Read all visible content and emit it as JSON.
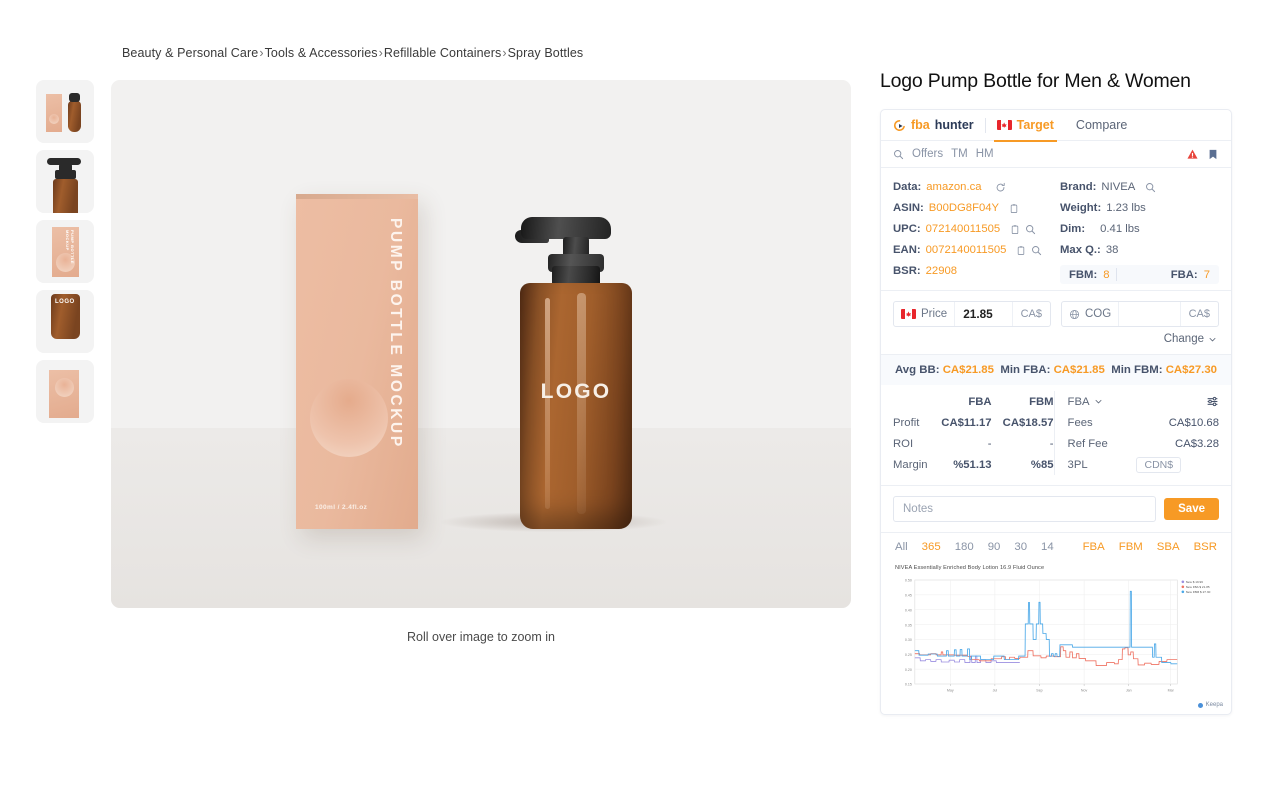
{
  "breadcrumb": {
    "items": [
      "Beauty & Personal Care",
      "Tools & Accessories",
      "Refillable Containers",
      "Spray Bottles"
    ],
    "separator": "›"
  },
  "gallery": {
    "zoom_caption": "Roll over image to zoom in",
    "thumbnails": [
      {
        "name": "thumbnail-box-and-bottle"
      },
      {
        "name": "thumbnail-pump-closeup"
      },
      {
        "name": "thumbnail-box-front"
      },
      {
        "name": "thumbnail-bottle-logo"
      },
      {
        "name": "thumbnail-box-angled"
      }
    ]
  },
  "product_image": {
    "box_text": "PUMP BOTTLE MOCKUP",
    "box_size": "100ml / 2.4fl.oz",
    "bottle_logo": "LOGO"
  },
  "panel": {
    "product_title": "Logo Pump Bottle for Men & Women",
    "brand_fba": "fba",
    "brand_hunter": "hunter",
    "tabs": [
      {
        "label": "Target",
        "active": true
      },
      {
        "label": "Compare",
        "active": false
      }
    ],
    "offers": {
      "offers_label": "Offers",
      "tm_label": "TM",
      "hm_label": "HM"
    },
    "data_left": [
      {
        "label": "Data:",
        "value": "amazon.ca"
      },
      {
        "label": "ASIN:",
        "value": "B00DG8F04Y"
      },
      {
        "label": "UPC:",
        "value": "072140011505"
      },
      {
        "label": "EAN:",
        "value": "0072140011505"
      },
      {
        "label": "BSR:",
        "value": "22908"
      }
    ],
    "data_right": [
      {
        "label": "Brand:",
        "value": "NIVEA"
      },
      {
        "label": "Weight:",
        "value": "1.23 lbs"
      },
      {
        "label": "Dim:",
        "value": "0.41 lbs"
      },
      {
        "label": "Max Q.:",
        "value": "38"
      }
    ],
    "fbm_label": "FBM:",
    "fbm_value": "8",
    "fba_label": "FBA:",
    "fba_value": "7",
    "price": {
      "label": "Price",
      "value": "21.85",
      "currency": "CA$"
    },
    "cog": {
      "label": "COG",
      "value": "",
      "currency": "CA$"
    },
    "change_label": "Change",
    "buybox": [
      {
        "label": "Avg BB:",
        "value": "CA$21.85"
      },
      {
        "label": "Min FBA:",
        "value": "CA$21.85"
      },
      {
        "label": "Min FBM:",
        "value": "CA$27.30"
      }
    ],
    "profit_table": {
      "col_fba": "FBA",
      "col_fbm": "FBM",
      "rows": [
        {
          "key": "Profit",
          "fba": "CA$11.17",
          "fbm": "CA$18.57",
          "green": true
        },
        {
          "key": "ROI",
          "fba": "-",
          "fbm": "-",
          "green": false
        },
        {
          "key": "Margin",
          "fba": "%51.13",
          "fbm": "%85",
          "green": true
        }
      ]
    },
    "fees_table": {
      "selector": "FBA",
      "rows": [
        {
          "key": "Fees",
          "value": "CA$10.68"
        },
        {
          "key": "Ref Fee",
          "value": "CA$3.28"
        }
      ],
      "threepl_key": "3PL",
      "threepl_chip": "CDN$"
    },
    "notes": {
      "placeholder": "Notes",
      "value": "",
      "save_label": "Save"
    },
    "filters": {
      "ranges": [
        {
          "label": "All",
          "active": false
        },
        {
          "label": "365",
          "active": true
        },
        {
          "label": "180",
          "active": false
        },
        {
          "label": "90",
          "active": false
        },
        {
          "label": "30",
          "active": false
        },
        {
          "label": "14",
          "active": false
        }
      ],
      "series_toggles": [
        {
          "label": "FBA",
          "active": true
        },
        {
          "label": "FBM",
          "active": true
        },
        {
          "label": "SBA",
          "active": true
        },
        {
          "label": "BSR",
          "active": true
        }
      ]
    },
    "keepa_label": "Keepa"
  },
  "chart_data": {
    "type": "line",
    "title": "NIVEA Essentially Enriched Body Lotion 16.9 Fluid Ounce",
    "xlabel": "",
    "ylabel": "",
    "ylim": [
      0.15,
      0.5
    ],
    "yticks": [
      0.15,
      0.2,
      0.25,
      0.3,
      0.35,
      0.4,
      0.45,
      0.5
    ],
    "ytick_labels": [
      "0.15",
      "0.20",
      "0.25",
      "0.30",
      "0.35",
      "0.40",
      "0.45",
      "0.50"
    ],
    "xticks": [
      0.135,
      0.305,
      0.475,
      0.645,
      0.815,
      0.975
    ],
    "xtick_labels": [
      "May",
      "Jul",
      "Sep",
      "Nov",
      "Jan",
      "Mar"
    ],
    "grid": true,
    "legend_position": "top-right",
    "legend": [
      {
        "label": "New $ 19.96",
        "color": "#9b8fe0"
      },
      {
        "label": "New FBA $ 21.85",
        "color": "#ef7363"
      },
      {
        "label": "New FBM $ 27.30",
        "color": "#4aa8e8"
      }
    ],
    "series": [
      {
        "name": "New FBM $ 27.30",
        "color": "#4aa8e8",
        "points": [
          [
            0.0,
            0.262
          ],
          [
            0.015,
            0.262
          ],
          [
            0.016,
            0.247
          ],
          [
            0.05,
            0.247
          ],
          [
            0.051,
            0.251
          ],
          [
            0.085,
            0.251
          ],
          [
            0.086,
            0.244
          ],
          [
            0.12,
            0.244
          ],
          [
            0.121,
            0.262
          ],
          [
            0.127,
            0.262
          ],
          [
            0.128,
            0.244
          ],
          [
            0.15,
            0.244
          ],
          [
            0.151,
            0.265
          ],
          [
            0.157,
            0.265
          ],
          [
            0.158,
            0.244
          ],
          [
            0.172,
            0.244
          ],
          [
            0.173,
            0.266
          ],
          [
            0.179,
            0.266
          ],
          [
            0.18,
            0.244
          ],
          [
            0.2,
            0.244
          ],
          [
            0.201,
            0.268
          ],
          [
            0.208,
            0.268
          ],
          [
            0.209,
            0.232
          ],
          [
            0.215,
            0.232
          ],
          [
            0.216,
            0.244
          ],
          [
            0.25,
            0.244
          ],
          [
            0.251,
            0.232
          ],
          [
            0.3,
            0.232
          ],
          [
            0.301,
            0.244
          ],
          [
            0.34,
            0.244
          ],
          [
            0.341,
            0.232
          ],
          [
            0.395,
            0.232
          ],
          [
            0.396,
            0.244
          ],
          [
            0.42,
            0.244
          ],
          [
            0.421,
            0.352
          ],
          [
            0.432,
            0.352
          ],
          [
            0.433,
            0.424
          ],
          [
            0.437,
            0.424
          ],
          [
            0.438,
            0.352
          ],
          [
            0.45,
            0.352
          ],
          [
            0.451,
            0.3
          ],
          [
            0.462,
            0.3
          ],
          [
            0.463,
            0.352
          ],
          [
            0.472,
            0.352
          ],
          [
            0.473,
            0.425
          ],
          [
            0.477,
            0.425
          ],
          [
            0.478,
            0.352
          ],
          [
            0.487,
            0.352
          ],
          [
            0.488,
            0.32
          ],
          [
            0.5,
            0.32
          ],
          [
            0.501,
            0.3
          ],
          [
            0.512,
            0.3
          ],
          [
            0.513,
            0.243
          ],
          [
            0.52,
            0.243
          ],
          [
            0.521,
            0.252
          ],
          [
            0.527,
            0.252
          ],
          [
            0.528,
            0.243
          ],
          [
            0.534,
            0.243
          ],
          [
            0.535,
            0.252
          ],
          [
            0.541,
            0.252
          ],
          [
            0.542,
            0.243
          ],
          [
            0.552,
            0.243
          ],
          [
            0.553,
            0.282
          ],
          [
            0.6,
            0.282
          ],
          [
            0.601,
            0.274
          ],
          [
            0.82,
            0.274
          ],
          [
            0.821,
            0.462
          ],
          [
            0.825,
            0.462
          ],
          [
            0.826,
            0.274
          ],
          [
            0.905,
            0.274
          ],
          [
            0.906,
            0.24
          ],
          [
            0.912,
            0.24
          ],
          [
            0.913,
            0.285
          ],
          [
            0.918,
            0.285
          ],
          [
            0.919,
            0.24
          ],
          [
            0.94,
            0.24
          ],
          [
            0.941,
            0.222
          ],
          [
            0.975,
            0.222
          ],
          [
            0.976,
            0.218
          ],
          [
            1.0,
            0.218
          ]
        ]
      },
      {
        "name": "New FBA $ 21.85",
        "color": "#ef7363",
        "points": [
          [
            0.0,
            0.252
          ],
          [
            0.018,
            0.252
          ],
          [
            0.019,
            0.248
          ],
          [
            0.06,
            0.248
          ],
          [
            0.061,
            0.252
          ],
          [
            0.08,
            0.252
          ],
          [
            0.081,
            0.248
          ],
          [
            0.1,
            0.248
          ],
          [
            0.101,
            0.258
          ],
          [
            0.106,
            0.258
          ],
          [
            0.107,
            0.248
          ],
          [
            0.15,
            0.248
          ],
          [
            0.151,
            0.247
          ],
          [
            0.2,
            0.247
          ],
          [
            0.201,
            0.243
          ],
          [
            0.215,
            0.243
          ],
          [
            0.216,
            0.232
          ],
          [
            0.245,
            0.232
          ],
          [
            0.246,
            0.228
          ],
          [
            0.29,
            0.228
          ],
          [
            0.291,
            0.235
          ],
          [
            0.33,
            0.235
          ],
          [
            0.331,
            0.242
          ],
          [
            0.345,
            0.242
          ],
          [
            0.346,
            0.232
          ],
          [
            0.36,
            0.232
          ],
          [
            0.361,
            0.24
          ],
          [
            0.38,
            0.24
          ],
          [
            0.381,
            0.236
          ],
          [
            0.4,
            0.236
          ],
          [
            0.401,
            0.24
          ],
          [
            0.43,
            0.24
          ],
          [
            0.431,
            0.262
          ],
          [
            0.45,
            0.262
          ],
          [
            0.451,
            0.245
          ],
          [
            0.48,
            0.245
          ],
          [
            0.481,
            0.238
          ],
          [
            0.5,
            0.238
          ],
          [
            0.501,
            0.244
          ],
          [
            0.53,
            0.244
          ],
          [
            0.531,
            0.242
          ],
          [
            0.555,
            0.242
          ],
          [
            0.556,
            0.275
          ],
          [
            0.565,
            0.275
          ],
          [
            0.566,
            0.262
          ],
          [
            0.575,
            0.262
          ],
          [
            0.576,
            0.24
          ],
          [
            0.59,
            0.24
          ],
          [
            0.591,
            0.258
          ],
          [
            0.6,
            0.258
          ],
          [
            0.601,
            0.238
          ],
          [
            0.615,
            0.238
          ],
          [
            0.616,
            0.252
          ],
          [
            0.625,
            0.252
          ],
          [
            0.626,
            0.236
          ],
          [
            0.65,
            0.236
          ],
          [
            0.651,
            0.228
          ],
          [
            0.69,
            0.228
          ],
          [
            0.691,
            0.212
          ],
          [
            0.73,
            0.212
          ],
          [
            0.731,
            0.222
          ],
          [
            0.76,
            0.222
          ],
          [
            0.761,
            0.218
          ],
          [
            0.775,
            0.218
          ],
          [
            0.776,
            0.232
          ],
          [
            0.79,
            0.232
          ],
          [
            0.791,
            0.268
          ],
          [
            0.8,
            0.268
          ],
          [
            0.801,
            0.272
          ],
          [
            0.812,
            0.272
          ],
          [
            0.813,
            0.248
          ],
          [
            0.822,
            0.248
          ],
          [
            0.823,
            0.258
          ],
          [
            0.832,
            0.258
          ],
          [
            0.833,
            0.235
          ],
          [
            0.85,
            0.235
          ],
          [
            0.851,
            0.214
          ],
          [
            0.875,
            0.214
          ],
          [
            0.876,
            0.22
          ],
          [
            0.9,
            0.22
          ],
          [
            0.901,
            0.216
          ],
          [
            0.93,
            0.216
          ],
          [
            0.931,
            0.226
          ],
          [
            0.96,
            0.226
          ],
          [
            0.961,
            0.232
          ],
          [
            1.0,
            0.232
          ]
        ]
      },
      {
        "name": "New $ 19.96",
        "color": "#9b8fe0",
        "points": [
          [
            0.0,
            0.238
          ],
          [
            0.02,
            0.238
          ],
          [
            0.021,
            0.228
          ],
          [
            0.04,
            0.228
          ],
          [
            0.041,
            0.232
          ],
          [
            0.06,
            0.232
          ],
          [
            0.061,
            0.226
          ],
          [
            0.08,
            0.226
          ],
          [
            0.081,
            0.232
          ],
          [
            0.1,
            0.232
          ],
          [
            0.101,
            0.224
          ],
          [
            0.13,
            0.224
          ],
          [
            0.131,
            0.23
          ],
          [
            0.15,
            0.23
          ],
          [
            0.151,
            0.224
          ],
          [
            0.17,
            0.224
          ],
          [
            0.171,
            0.232
          ],
          [
            0.19,
            0.232
          ],
          [
            0.191,
            0.222
          ],
          [
            0.21,
            0.222
          ],
          [
            0.211,
            0.244
          ],
          [
            0.216,
            0.244
          ],
          [
            0.217,
            0.222
          ],
          [
            0.23,
            0.222
          ],
          [
            0.231,
            0.244
          ],
          [
            0.236,
            0.244
          ],
          [
            0.237,
            0.222
          ],
          [
            0.25,
            0.222
          ],
          [
            0.251,
            0.232
          ],
          [
            0.27,
            0.232
          ],
          [
            0.271,
            0.222
          ],
          [
            0.29,
            0.222
          ],
          [
            0.291,
            0.228
          ],
          [
            0.31,
            0.228
          ],
          [
            0.311,
            0.222
          ],
          [
            0.34,
            0.222
          ],
          [
            0.341,
            0.222
          ],
          [
            0.395,
            0.222
          ],
          [
            0.396,
            0.222
          ],
          [
            0.4,
            0.222
          ]
        ]
      }
    ]
  }
}
